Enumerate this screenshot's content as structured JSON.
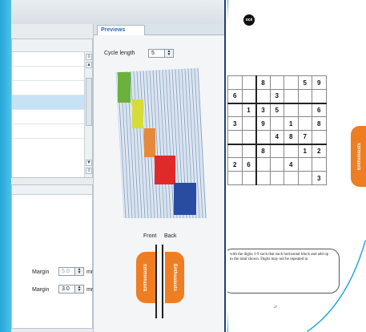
{
  "previews": {
    "tab_label": "Previews",
    "cycle_label": "Cycle length",
    "cycle_value": "5",
    "front_label": "Front",
    "back_label": "Back",
    "tab_text": "Enthusiasts",
    "sheet_colors": [
      "#6ab23b",
      "#d6dc3a",
      "#e8893a",
      "#e02a2a",
      "#2a4ba2"
    ]
  },
  "margins": [
    {
      "label": "Margin",
      "value": "5.0",
      "unit": "mm",
      "enabled": false
    },
    {
      "label": "Margin",
      "value": "3.0",
      "unit": "mm",
      "enabled": true
    }
  ],
  "scroll": {
    "up": "▲",
    "down": "▼",
    "top": "≡",
    "bottom": "≡"
  },
  "document": {
    "logo": "océ",
    "side_tab": "Enthusiasts",
    "sudoku_rows": [
      [
        "",
        "",
        "8",
        "",
        "",
        "5",
        "9"
      ],
      [
        "6",
        "",
        "",
        "3",
        "",
        "",
        ""
      ],
      [
        "",
        "1",
        "3",
        "5",
        "",
        "",
        "6"
      ],
      [
        "3",
        "",
        "9",
        "",
        "1",
        "",
        "8"
      ],
      [
        "",
        "",
        "",
        "4",
        "8",
        "7",
        ""
      ],
      [
        "",
        "",
        "8",
        "",
        "",
        "1",
        "2"
      ],
      [
        "2",
        "6",
        "",
        "",
        "4",
        "",
        ""
      ],
      [
        "",
        "",
        "",
        "",
        "",
        "",
        "3"
      ]
    ],
    "caption": "with the digits 1-9 such that each horizontal block and add up to the total shown. Digits may not be repeated in",
    "page_number": "27"
  },
  "colors": {
    "accent_blue": "#2b6ab3",
    "orange": "#ef7d22",
    "cyan_edge": "#24a6d9"
  }
}
